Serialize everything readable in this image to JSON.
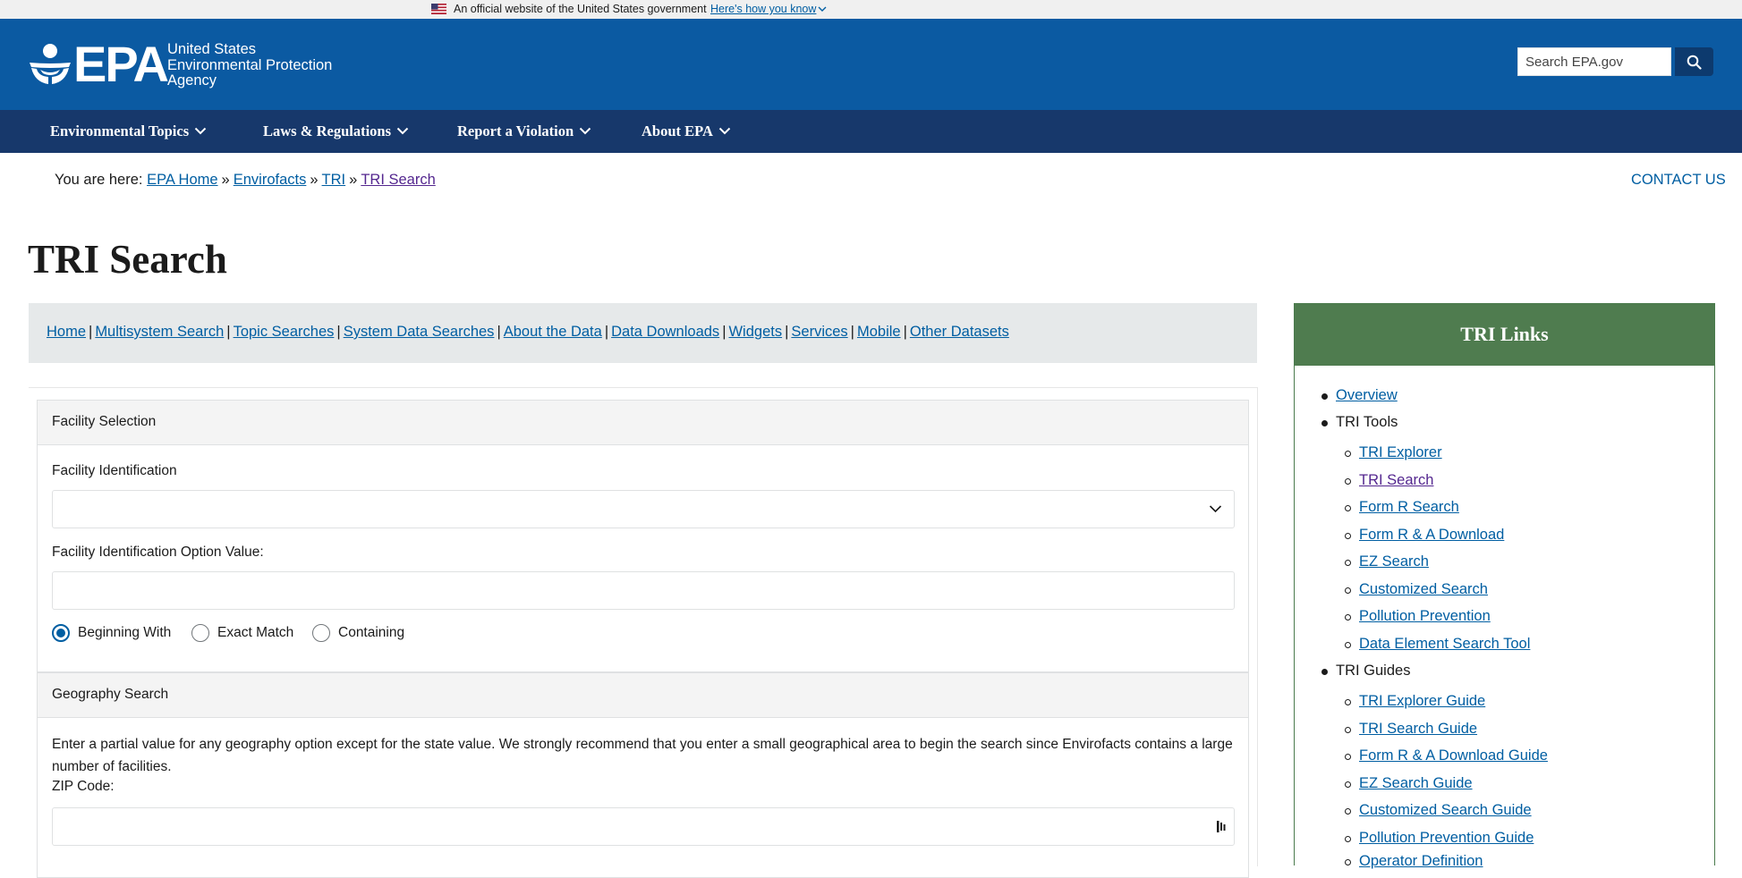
{
  "banner": {
    "official_text": "An official website of the United States government",
    "how_link": "Here's how you know"
  },
  "header": {
    "logo_text": "EPA",
    "agency_lines": [
      "United States",
      "Environmental Protection",
      "Agency"
    ],
    "search_placeholder": "Search EPA.gov"
  },
  "nav": {
    "items": [
      "Environmental Topics",
      "Laws & Regulations",
      "Report a Violation",
      "About EPA"
    ]
  },
  "breadcrumb": {
    "prefix": "You are here:",
    "items": [
      "EPA Home",
      "Envirofacts",
      "TRI",
      "TRI Search"
    ],
    "separator": "»"
  },
  "contact_label": "CONTACT US",
  "page_title": "TRI Search",
  "subnav": {
    "items": [
      "Home",
      "Multisystem Search",
      "Topic Searches",
      "System Data Searches",
      "About the Data",
      "Data Downloads",
      "Widgets",
      "Services",
      "Mobile",
      "Other Datasets"
    ],
    "separator": "|"
  },
  "facility_section": {
    "title": "Facility Selection",
    "id_label": "Facility Identification",
    "id_value": "",
    "option_label": "Facility Identification Option Value:",
    "option_value": "",
    "match_options": [
      "Beginning With",
      "Exact Match",
      "Containing"
    ],
    "selected_match": "Beginning With"
  },
  "geography_section": {
    "title": "Geography Search",
    "description": "Enter a partial value for any geography option except for the state value. We strongly recommend that you enter a small geographical area to begin the search since Envirofacts contains a large number of facilities.",
    "zip_label": "ZIP Code:",
    "zip_value": ""
  },
  "sidebar": {
    "title": "TRI Links",
    "overview": "Overview",
    "tools_heading": "TRI Tools",
    "tools": [
      "TRI Explorer",
      "TRI Search",
      "Form R Search",
      "Form R & A Download",
      "EZ Search",
      "Customized Search",
      "Pollution Prevention",
      "Data Element Search Tool"
    ],
    "guides_heading": "TRI Guides",
    "guides": [
      "TRI Explorer Guide",
      "TRI Search Guide",
      "Form R & A Download Guide",
      "EZ Search Guide",
      "Customized Search Guide",
      "Pollution Prevention Guide",
      "Operator Definition"
    ]
  },
  "colors": {
    "header_blue": "#0b5aa2",
    "nav_navy": "#17386b",
    "link_blue": "#005ea2",
    "visited_purple": "#54278f",
    "sidebar_green": "#4f7c4f"
  }
}
